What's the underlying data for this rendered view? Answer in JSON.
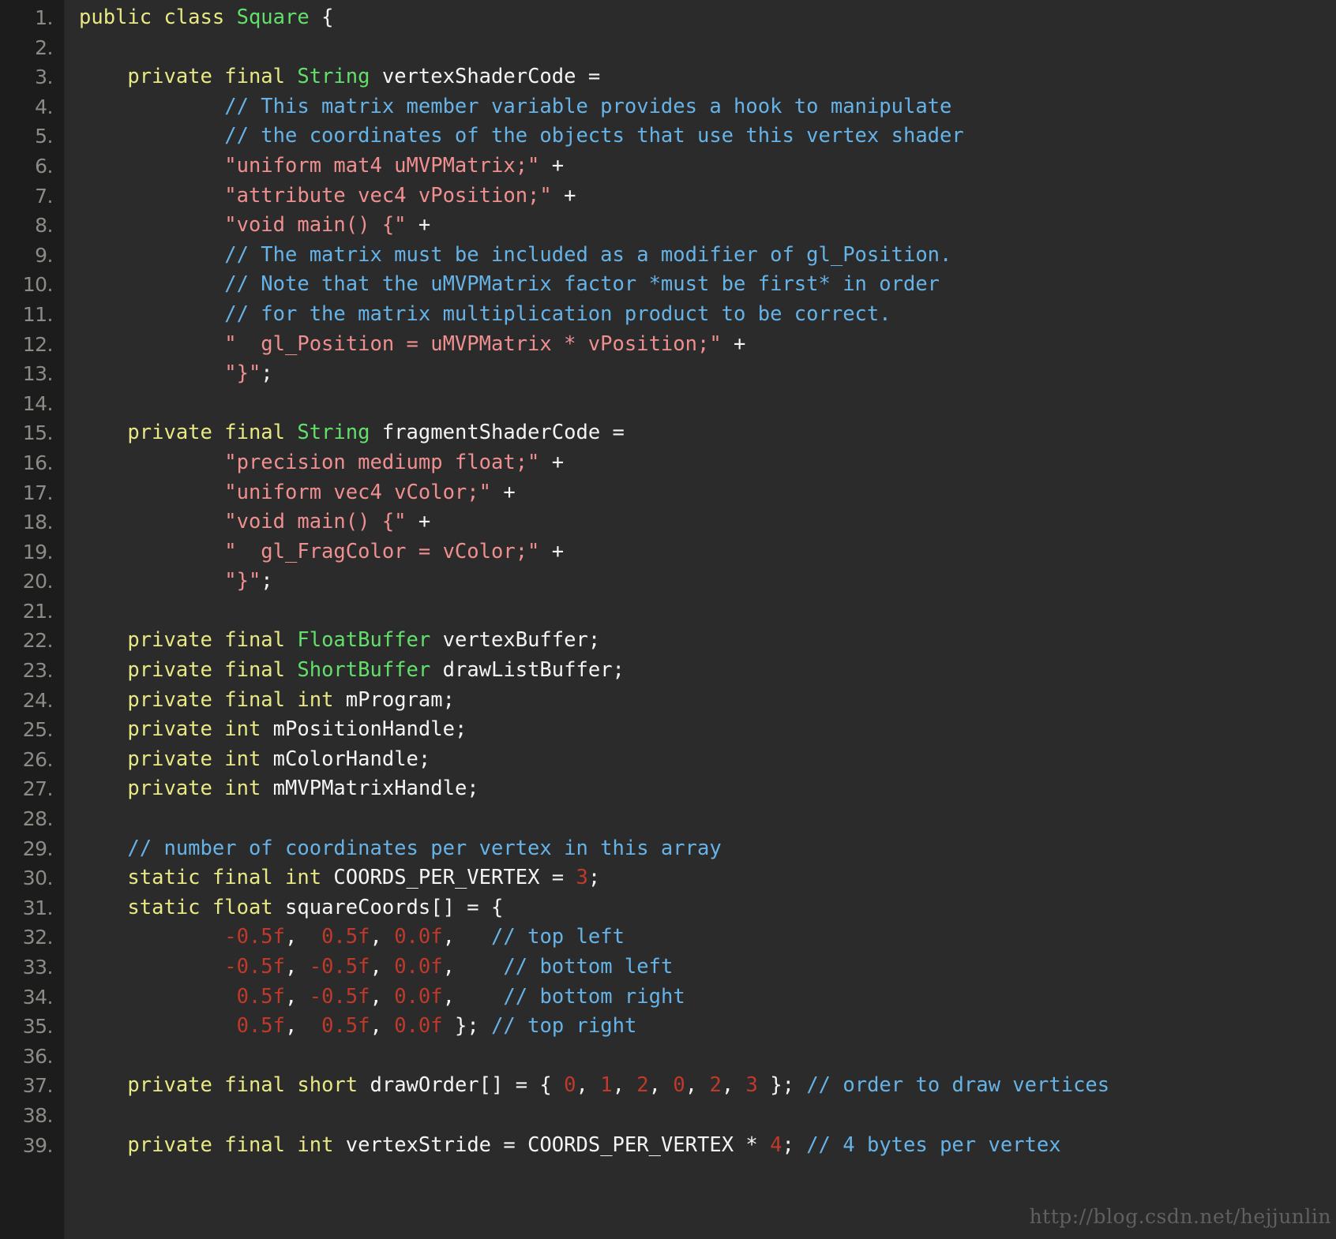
{
  "editor": {
    "language": "java",
    "theme": "dark",
    "background_color": "#2b2b2b",
    "gutter_color": "#1c1c1c",
    "line_number_color": "#8c8c86",
    "total_lines": 39,
    "first_visible_line": 1,
    "last_visible_line": 39
  },
  "palette": {
    "keyword": "#e8e884",
    "type": "#62e06b",
    "string": "#f08f8f",
    "comment": "#66b3e8",
    "number": "#c0392b",
    "plain": "#f4f4f4"
  },
  "watermark": {
    "text": "http://blog.csdn.net/hejjunlin"
  },
  "line_numbers": [
    "1.",
    "2.",
    "3.",
    "4.",
    "5.",
    "6.",
    "7.",
    "8.",
    "9.",
    "10.",
    "11.",
    "12.",
    "13.",
    "14.",
    "15.",
    "16.",
    "17.",
    "18.",
    "19.",
    "20.",
    "21.",
    "22.",
    "23.",
    "24.",
    "25.",
    "26.",
    "27.",
    "28.",
    "29.",
    "30.",
    "31.",
    "32.",
    "33.",
    "34.",
    "35.",
    "36.",
    "37.",
    "38.",
    "39."
  ],
  "lines": [
    {
      "n": 1,
      "text": "public class Square {",
      "tokens": [
        {
          "t": "public ",
          "c": "kw"
        },
        {
          "t": "class ",
          "c": "kw"
        },
        {
          "t": "Square",
          "c": "type"
        },
        {
          "t": " {",
          "c": "pln"
        }
      ]
    },
    {
      "n": 2,
      "text": "",
      "tokens": []
    },
    {
      "n": 3,
      "text": "    private final String vertexShaderCode =",
      "tokens": [
        {
          "t": "    ",
          "c": "pln"
        },
        {
          "t": "private ",
          "c": "kw"
        },
        {
          "t": "final ",
          "c": "kw"
        },
        {
          "t": "String",
          "c": "type"
        },
        {
          "t": " vertexShaderCode =",
          "c": "pln"
        }
      ]
    },
    {
      "n": 4,
      "text": "            // This matrix member variable provides a hook to manipulate",
      "tokens": [
        {
          "t": "            ",
          "c": "pln"
        },
        {
          "t": "// This matrix member variable provides a hook to manipulate",
          "c": "com"
        }
      ]
    },
    {
      "n": 5,
      "text": "            // the coordinates of the objects that use this vertex shader",
      "tokens": [
        {
          "t": "            ",
          "c": "pln"
        },
        {
          "t": "// the coordinates of the objects that use this vertex shader",
          "c": "com"
        }
      ]
    },
    {
      "n": 6,
      "text": "            \"uniform mat4 uMVPMatrix;\" +",
      "tokens": [
        {
          "t": "            ",
          "c": "pln"
        },
        {
          "t": "\"uniform mat4 uMVPMatrix;\"",
          "c": "str"
        },
        {
          "t": " +",
          "c": "pln"
        }
      ]
    },
    {
      "n": 7,
      "text": "            \"attribute vec4 vPosition;\" +",
      "tokens": [
        {
          "t": "            ",
          "c": "pln"
        },
        {
          "t": "\"attribute vec4 vPosition;\"",
          "c": "str"
        },
        {
          "t": " +",
          "c": "pln"
        }
      ]
    },
    {
      "n": 8,
      "text": "            \"void main() {\" +",
      "tokens": [
        {
          "t": "            ",
          "c": "pln"
        },
        {
          "t": "\"void main() {\"",
          "c": "str"
        },
        {
          "t": " +",
          "c": "pln"
        }
      ]
    },
    {
      "n": 9,
      "text": "            // The matrix must be included as a modifier of gl_Position.",
      "tokens": [
        {
          "t": "            ",
          "c": "pln"
        },
        {
          "t": "// The matrix must be included as a modifier of gl_Position.",
          "c": "com"
        }
      ]
    },
    {
      "n": 10,
      "text": "            // Note that the uMVPMatrix factor *must be first* in order",
      "tokens": [
        {
          "t": "            ",
          "c": "pln"
        },
        {
          "t": "// Note that the uMVPMatrix factor *must be first* in order",
          "c": "com"
        }
      ]
    },
    {
      "n": 11,
      "text": "            // for the matrix multiplication product to be correct.",
      "tokens": [
        {
          "t": "            ",
          "c": "pln"
        },
        {
          "t": "// for the matrix multiplication product to be correct.",
          "c": "com"
        }
      ]
    },
    {
      "n": 12,
      "text": "            \"  gl_Position = uMVPMatrix * vPosition;\" +",
      "tokens": [
        {
          "t": "            ",
          "c": "pln"
        },
        {
          "t": "\"  gl_Position = uMVPMatrix * vPosition;\"",
          "c": "str"
        },
        {
          "t": " +",
          "c": "pln"
        }
      ]
    },
    {
      "n": 13,
      "text": "            \"}\";",
      "tokens": [
        {
          "t": "            ",
          "c": "pln"
        },
        {
          "t": "\"}\"",
          "c": "str"
        },
        {
          "t": ";",
          "c": "pln"
        }
      ]
    },
    {
      "n": 14,
      "text": "",
      "tokens": []
    },
    {
      "n": 15,
      "text": "    private final String fragmentShaderCode =",
      "tokens": [
        {
          "t": "    ",
          "c": "pln"
        },
        {
          "t": "private ",
          "c": "kw"
        },
        {
          "t": "final ",
          "c": "kw"
        },
        {
          "t": "String",
          "c": "type"
        },
        {
          "t": " fragmentShaderCode =",
          "c": "pln"
        }
      ]
    },
    {
      "n": 16,
      "text": "            \"precision mediump float;\" +",
      "tokens": [
        {
          "t": "            ",
          "c": "pln"
        },
        {
          "t": "\"precision mediump float;\"",
          "c": "str"
        },
        {
          "t": " +",
          "c": "pln"
        }
      ]
    },
    {
      "n": 17,
      "text": "            \"uniform vec4 vColor;\" +",
      "tokens": [
        {
          "t": "            ",
          "c": "pln"
        },
        {
          "t": "\"uniform vec4 vColor;\"",
          "c": "str"
        },
        {
          "t": " +",
          "c": "pln"
        }
      ]
    },
    {
      "n": 18,
      "text": "            \"void main() {\" +",
      "tokens": [
        {
          "t": "            ",
          "c": "pln"
        },
        {
          "t": "\"void main() {\"",
          "c": "str"
        },
        {
          "t": " +",
          "c": "pln"
        }
      ]
    },
    {
      "n": 19,
      "text": "            \"  gl_FragColor = vColor;\" +",
      "tokens": [
        {
          "t": "            ",
          "c": "pln"
        },
        {
          "t": "\"  gl_FragColor = vColor;\"",
          "c": "str"
        },
        {
          "t": " +",
          "c": "pln"
        }
      ]
    },
    {
      "n": 20,
      "text": "            \"}\";",
      "tokens": [
        {
          "t": "            ",
          "c": "pln"
        },
        {
          "t": "\"}\"",
          "c": "str"
        },
        {
          "t": ";",
          "c": "pln"
        }
      ]
    },
    {
      "n": 21,
      "text": "",
      "tokens": []
    },
    {
      "n": 22,
      "text": "    private final FloatBuffer vertexBuffer;",
      "tokens": [
        {
          "t": "    ",
          "c": "pln"
        },
        {
          "t": "private ",
          "c": "kw"
        },
        {
          "t": "final ",
          "c": "kw"
        },
        {
          "t": "FloatBuffer",
          "c": "type"
        },
        {
          "t": " vertexBuffer;",
          "c": "pln"
        }
      ]
    },
    {
      "n": 23,
      "text": "    private final ShortBuffer drawListBuffer;",
      "tokens": [
        {
          "t": "    ",
          "c": "pln"
        },
        {
          "t": "private ",
          "c": "kw"
        },
        {
          "t": "final ",
          "c": "kw"
        },
        {
          "t": "ShortBuffer",
          "c": "type"
        },
        {
          "t": " drawListBuffer;",
          "c": "pln"
        }
      ]
    },
    {
      "n": 24,
      "text": "    private final int mProgram;",
      "tokens": [
        {
          "t": "    ",
          "c": "pln"
        },
        {
          "t": "private ",
          "c": "kw"
        },
        {
          "t": "final ",
          "c": "kw"
        },
        {
          "t": "int",
          "c": "kw"
        },
        {
          "t": " mProgram;",
          "c": "pln"
        }
      ]
    },
    {
      "n": 25,
      "text": "    private int mPositionHandle;",
      "tokens": [
        {
          "t": "    ",
          "c": "pln"
        },
        {
          "t": "private ",
          "c": "kw"
        },
        {
          "t": "int",
          "c": "kw"
        },
        {
          "t": " mPositionHandle;",
          "c": "pln"
        }
      ]
    },
    {
      "n": 26,
      "text": "    private int mColorHandle;",
      "tokens": [
        {
          "t": "    ",
          "c": "pln"
        },
        {
          "t": "private ",
          "c": "kw"
        },
        {
          "t": "int",
          "c": "kw"
        },
        {
          "t": " mColorHandle;",
          "c": "pln"
        }
      ]
    },
    {
      "n": 27,
      "text": "    private int mMVPMatrixHandle;",
      "tokens": [
        {
          "t": "    ",
          "c": "pln"
        },
        {
          "t": "private ",
          "c": "kw"
        },
        {
          "t": "int",
          "c": "kw"
        },
        {
          "t": " mMVPMatrixHandle;",
          "c": "pln"
        }
      ]
    },
    {
      "n": 28,
      "text": "",
      "tokens": []
    },
    {
      "n": 29,
      "text": "    // number of coordinates per vertex in this array",
      "tokens": [
        {
          "t": "    ",
          "c": "pln"
        },
        {
          "t": "// number of coordinates per vertex in this array",
          "c": "com"
        }
      ]
    },
    {
      "n": 30,
      "text": "    static final int COORDS_PER_VERTEX = 3;",
      "tokens": [
        {
          "t": "    ",
          "c": "pln"
        },
        {
          "t": "static ",
          "c": "kw"
        },
        {
          "t": "final ",
          "c": "kw"
        },
        {
          "t": "int",
          "c": "kw"
        },
        {
          "t": " COORDS_PER_VERTEX = ",
          "c": "pln"
        },
        {
          "t": "3",
          "c": "num"
        },
        {
          "t": ";",
          "c": "pln"
        }
      ]
    },
    {
      "n": 31,
      "text": "    static float squareCoords[] = {",
      "tokens": [
        {
          "t": "    ",
          "c": "pln"
        },
        {
          "t": "static ",
          "c": "kw"
        },
        {
          "t": "float",
          "c": "kw"
        },
        {
          "t": " squareCoords[] = {",
          "c": "pln"
        }
      ]
    },
    {
      "n": 32,
      "text": "            -0.5f,  0.5f, 0.0f,   // top left",
      "tokens": [
        {
          "t": "            ",
          "c": "pln"
        },
        {
          "t": "-0.5f",
          "c": "num"
        },
        {
          "t": ", ",
          "c": "pln"
        },
        {
          "t": " 0.5f",
          "c": "num"
        },
        {
          "t": ", ",
          "c": "pln"
        },
        {
          "t": "0.0f",
          "c": "num"
        },
        {
          "t": ",   ",
          "c": "pln"
        },
        {
          "t": "// top left",
          "c": "com"
        }
      ]
    },
    {
      "n": 33,
      "text": "            -0.5f, -0.5f, 0.0f,    // bottom left",
      "tokens": [
        {
          "t": "            ",
          "c": "pln"
        },
        {
          "t": "-0.5f",
          "c": "num"
        },
        {
          "t": ", ",
          "c": "pln"
        },
        {
          "t": "-0.5f",
          "c": "num"
        },
        {
          "t": ", ",
          "c": "pln"
        },
        {
          "t": "0.0f",
          "c": "num"
        },
        {
          "t": ",    ",
          "c": "pln"
        },
        {
          "t": "// bottom left",
          "c": "com"
        }
      ]
    },
    {
      "n": 34,
      "text": "             0.5f, -0.5f, 0.0f,    // bottom right",
      "tokens": [
        {
          "t": "             ",
          "c": "pln"
        },
        {
          "t": "0.5f",
          "c": "num"
        },
        {
          "t": ", ",
          "c": "pln"
        },
        {
          "t": "-0.5f",
          "c": "num"
        },
        {
          "t": ", ",
          "c": "pln"
        },
        {
          "t": "0.0f",
          "c": "num"
        },
        {
          "t": ",    ",
          "c": "pln"
        },
        {
          "t": "// bottom right",
          "c": "com"
        }
      ]
    },
    {
      "n": 35,
      "text": "             0.5f,  0.5f, 0.0f }; // top right",
      "tokens": [
        {
          "t": "             ",
          "c": "pln"
        },
        {
          "t": "0.5f",
          "c": "num"
        },
        {
          "t": ", ",
          "c": "pln"
        },
        {
          "t": " 0.5f",
          "c": "num"
        },
        {
          "t": ", ",
          "c": "pln"
        },
        {
          "t": "0.0f",
          "c": "num"
        },
        {
          "t": " }; ",
          "c": "pln"
        },
        {
          "t": "// top right",
          "c": "com"
        }
      ]
    },
    {
      "n": 36,
      "text": "",
      "tokens": []
    },
    {
      "n": 37,
      "text": "    private final short drawOrder[] = { 0, 1, 2, 0, 2, 3 }; // order to draw vertices",
      "tokens": [
        {
          "t": "    ",
          "c": "pln"
        },
        {
          "t": "private ",
          "c": "kw"
        },
        {
          "t": "final ",
          "c": "kw"
        },
        {
          "t": "short",
          "c": "kw"
        },
        {
          "t": " drawOrder[] = { ",
          "c": "pln"
        },
        {
          "t": "0",
          "c": "num"
        },
        {
          "t": ", ",
          "c": "pln"
        },
        {
          "t": "1",
          "c": "num"
        },
        {
          "t": ", ",
          "c": "pln"
        },
        {
          "t": "2",
          "c": "num"
        },
        {
          "t": ", ",
          "c": "pln"
        },
        {
          "t": "0",
          "c": "num"
        },
        {
          "t": ", ",
          "c": "pln"
        },
        {
          "t": "2",
          "c": "num"
        },
        {
          "t": ", ",
          "c": "pln"
        },
        {
          "t": "3",
          "c": "num"
        },
        {
          "t": " }; ",
          "c": "pln"
        },
        {
          "t": "// order to draw vertices",
          "c": "com"
        }
      ]
    },
    {
      "n": 38,
      "text": "",
      "tokens": []
    },
    {
      "n": 39,
      "text": "    private final int vertexStride = COORDS_PER_VERTEX * 4; // 4 bytes per vertex",
      "tokens": [
        {
          "t": "    ",
          "c": "pln"
        },
        {
          "t": "private ",
          "c": "kw"
        },
        {
          "t": "final ",
          "c": "kw"
        },
        {
          "t": "int",
          "c": "kw"
        },
        {
          "t": " vertexStride = COORDS_PER_VERTEX * ",
          "c": "pln"
        },
        {
          "t": "4",
          "c": "num"
        },
        {
          "t": "; ",
          "c": "pln"
        },
        {
          "t": "// 4 bytes per vertex",
          "c": "com"
        }
      ]
    }
  ]
}
